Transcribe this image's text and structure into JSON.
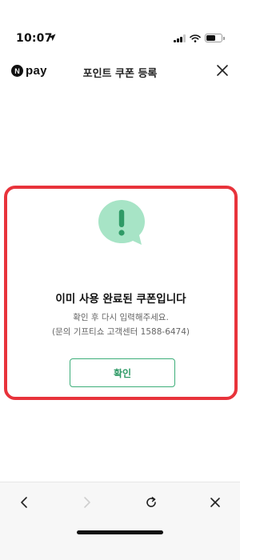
{
  "status_bar": {
    "time": "10:07",
    "location_icon": "location-arrow-icon",
    "signal_icon": "cellular-signal-icon",
    "wifi_icon": "wifi-icon",
    "battery_icon": "battery-icon"
  },
  "header": {
    "logo_mark": "N",
    "logo_text": "pay",
    "title": "포인트 쿠폰 등록",
    "close_icon": "close-icon"
  },
  "dialog": {
    "icon": "exclamation-speech-bubble-icon",
    "title": "이미 사용 완료된 쿠폰입니다",
    "message_line1": "확인 후 다시 입력해주세요.",
    "message_line2": "(문의 기프티쇼 고객센터 1588-6474)",
    "confirm_label": "확인",
    "accent_color": "#3cae79",
    "highlight_border_color": "#e8333b"
  },
  "toolbar": {
    "back_icon": "chevron-left-icon",
    "forward_icon": "chevron-right-icon",
    "reload_icon": "reload-icon",
    "close_icon": "close-icon"
  }
}
